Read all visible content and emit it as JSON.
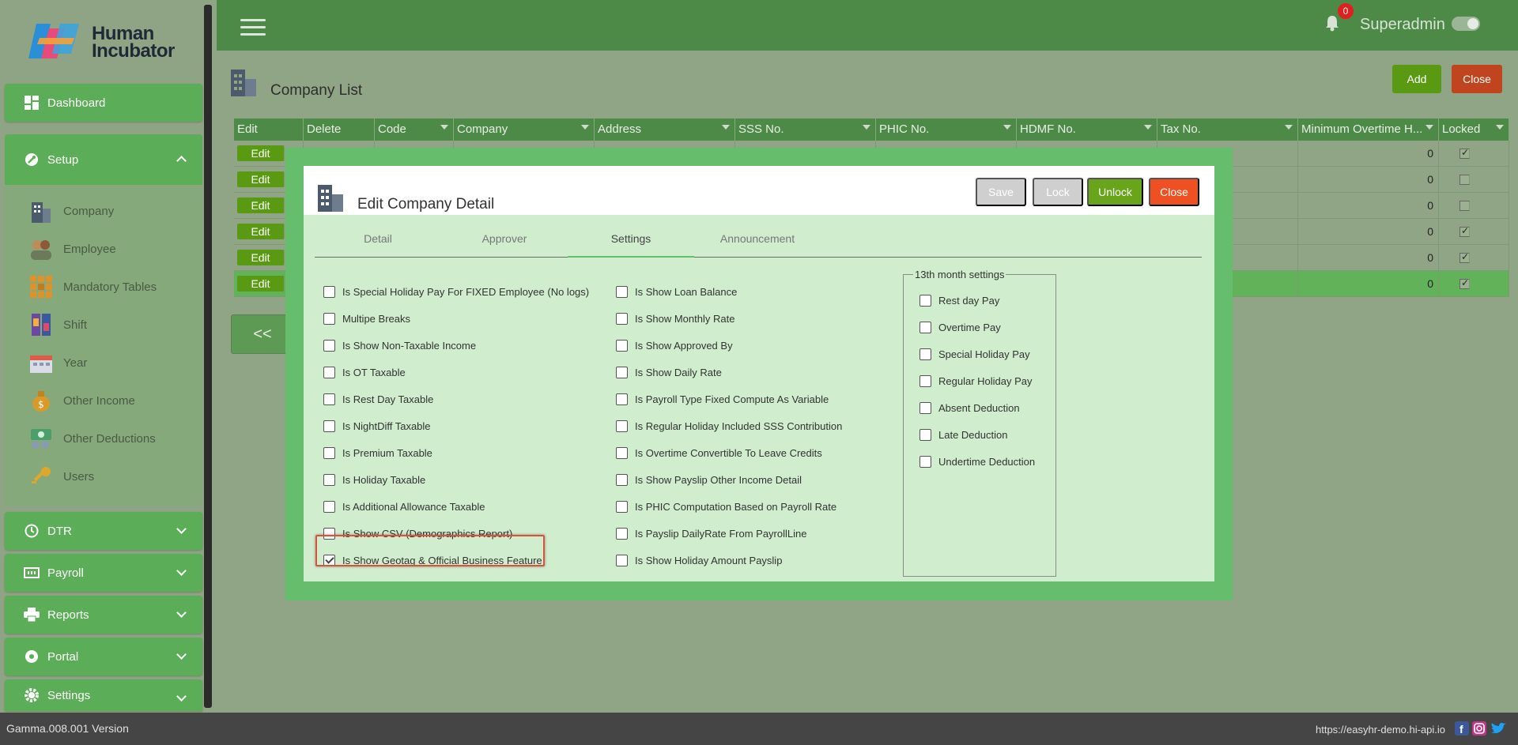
{
  "brand": {
    "name_line1": "Human",
    "name_line2": "Incubator"
  },
  "sidebar": {
    "dashboard": "Dashboard",
    "setup": "Setup",
    "setup_items": [
      "Company",
      "Employee",
      "Mandatory Tables",
      "Shift",
      "Year",
      "Other Income",
      "Other Deductions",
      "Users"
    ],
    "dtr": "DTR",
    "payroll": "Payroll",
    "reports": "Reports",
    "portal": "Portal",
    "settings": "Settings"
  },
  "header": {
    "notification_count": "0",
    "user": "Superadmin"
  },
  "page": {
    "title": "Company List",
    "add_label": "Add",
    "close_label": "Close"
  },
  "grid": {
    "columns": [
      "Edit",
      "Delete",
      "Code",
      "Company",
      "Address",
      "SSS No.",
      "PHIC No.",
      "HDMF No.",
      "Tax No.",
      "Minimum Overtime H...",
      "Locked"
    ],
    "edit_label": "Edit",
    "rows": [
      {
        "min_ot": "0",
        "locked": true
      },
      {
        "min_ot": "0",
        "locked": false
      },
      {
        "min_ot": "0",
        "locked": false
      },
      {
        "min_ot": "0",
        "locked": true
      },
      {
        "min_ot": "0",
        "locked": true
      },
      {
        "min_ot": "0",
        "locked": true
      }
    ],
    "pager_prev": "<<"
  },
  "modal": {
    "title": "Edit Company Detail",
    "save": "Save",
    "lock": "Lock",
    "unlock": "Unlock",
    "close": "Close",
    "tabs": [
      "Detail",
      "Approver",
      "Settings",
      "Announcement"
    ],
    "active_tab": "Settings",
    "col1": [
      {
        "label": "Is Special Holiday Pay For FIXED Employee (No logs)",
        "checked": false
      },
      {
        "label": "Multipe Breaks",
        "checked": false
      },
      {
        "label": "Is Show Non-Taxable Income",
        "checked": false
      },
      {
        "label": "Is OT Taxable",
        "checked": false
      },
      {
        "label": "Is Rest Day Taxable",
        "checked": false
      },
      {
        "label": "Is NightDiff Taxable",
        "checked": false
      },
      {
        "label": "Is Premium Taxable",
        "checked": false
      },
      {
        "label": "Is Holiday Taxable",
        "checked": false
      },
      {
        "label": "Is Additional Allowance Taxable",
        "checked": false
      },
      {
        "label": "Is Show CSV (Demographics Report)",
        "checked": false
      },
      {
        "label": "Is Show Geotag & Official Business Feature",
        "checked": true
      }
    ],
    "col2": [
      {
        "label": "Is Show Loan Balance",
        "checked": false
      },
      {
        "label": "Is Show Monthly Rate",
        "checked": false
      },
      {
        "label": "Is Show Approved By",
        "checked": false
      },
      {
        "label": "Is Show Daily Rate",
        "checked": false
      },
      {
        "label": "Is Payroll Type Fixed Compute As Variable",
        "checked": false
      },
      {
        "label": "Is Regular Holiday Included SSS Contribution",
        "checked": false
      },
      {
        "label": "Is Overtime Convertible To Leave Credits",
        "checked": false
      },
      {
        "label": "Is Show Payslip Other Income Detail",
        "checked": false
      },
      {
        "label": "Is PHIC Computation Based on Payroll Rate",
        "checked": false
      },
      {
        "label": "Is Payslip DailyRate From PayrollLine",
        "checked": false
      },
      {
        "label": "Is Show Holiday Amount Payslip",
        "checked": false
      }
    ],
    "month13_title": "13th month settings",
    "month13": [
      {
        "label": "Rest day Pay",
        "checked": false
      },
      {
        "label": "Overtime Pay",
        "checked": false
      },
      {
        "label": "Special Holiday Pay",
        "checked": false
      },
      {
        "label": "Regular Holiday Pay",
        "checked": false
      },
      {
        "label": "Absent Deduction",
        "checked": false
      },
      {
        "label": "Late Deduction",
        "checked": false
      },
      {
        "label": "Undertime Deduction",
        "checked": false
      }
    ]
  },
  "footer": {
    "version": "Gamma.008.001 Version",
    "url": "https://easyhr-demo.hi-api.io"
  },
  "colors": {
    "primary": "#4d8a48",
    "accent": "#5cad57",
    "danger": "#ef5022",
    "success": "#68a51b"
  }
}
